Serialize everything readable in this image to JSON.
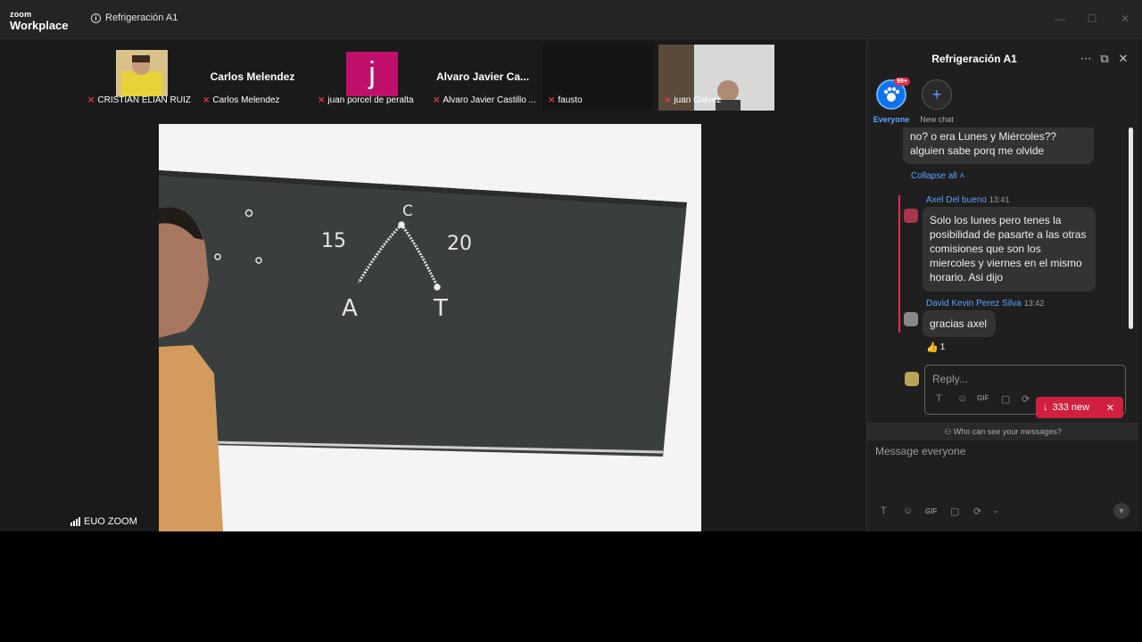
{
  "app": {
    "brand_top": "zoom",
    "brand_bottom": "Workplace",
    "meeting_title": "Refrigeración A1"
  },
  "window_controls": {
    "minimize": "—",
    "maximize": "☐",
    "close": "✕"
  },
  "gallery": [
    {
      "name": "CRISTIAN ELIAN RUIZ",
      "display": "video"
    },
    {
      "name": "Carlos Melendez",
      "display": "name"
    },
    {
      "name": "juan porcel de peralta",
      "display": "initial",
      "initial": "j",
      "color": "#c0106b"
    },
    {
      "name": "Alvaro Javier Castillo ...",
      "display": "name",
      "center_name": "Alvaro Javier Ca..."
    },
    {
      "name": "fausto",
      "display": "dark"
    },
    {
      "name": "juan Galvez",
      "display": "video"
    }
  ],
  "main_video": {
    "speaker": "EUO ZOOM",
    "board_text": {
      "left_num": "15",
      "right_num": "20",
      "top_letter": "C",
      "bottom_left": "A",
      "bottom_right": "T"
    }
  },
  "chat": {
    "title": "Refrigeración A1",
    "icons": {
      "more": "⋯",
      "popout": "⧉",
      "close": "✕"
    },
    "channels": [
      {
        "label": "Everyone",
        "badge": "99+",
        "active": true
      },
      {
        "label": "New chat",
        "symbol": "+"
      }
    ],
    "prev_message": {
      "text": "no? o era Lunes y Miércoles?? alguien sabe porq me olvide"
    },
    "collapse_label": "Collapse all",
    "thread": [
      {
        "sender": "Axel Del bueno",
        "time": "13:41",
        "text": "Solo los lunes pero tenes la posibilidad de pasarte a las otras comisiones que son los miercoles y viernes en el mismo horario. Asi dijo"
      },
      {
        "sender": "David Kevin Perez Silva",
        "time": "13:42",
        "text": "gracias axel",
        "reaction": {
          "emoji": "👍",
          "count": "1"
        }
      }
    ],
    "reply_placeholder": "Reply...",
    "new_messages": {
      "label": "333 new"
    },
    "privacy_text": "Who can see your messages?",
    "composer_placeholder": "Message everyone",
    "toolbar": [
      "T",
      "☺",
      "GIF",
      "▢",
      "⟳"
    ]
  },
  "colors": {
    "accent": "#0e72ed",
    "danger": "#d0203f",
    "panel": "#1f1f1f"
  }
}
